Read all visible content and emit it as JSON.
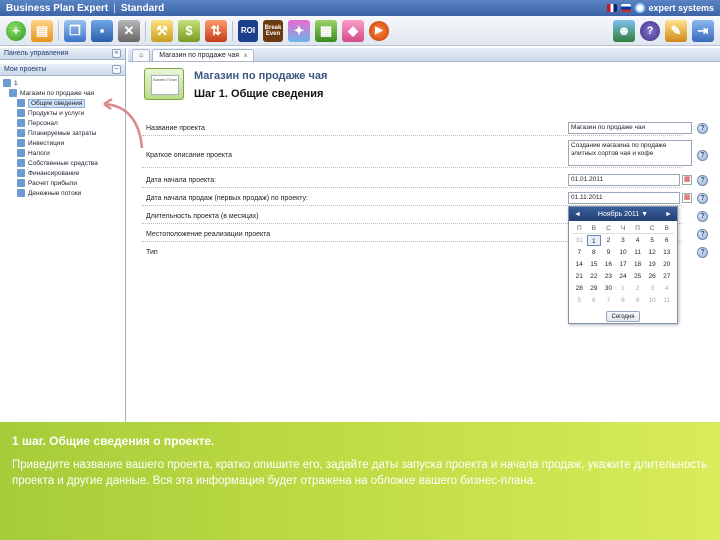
{
  "titlebar": {
    "brand": "Business Plan Expert",
    "separator": "|",
    "edition": "Standard",
    "company": "expert systems"
  },
  "toolbar": {
    "icons": [
      "add-icon",
      "open-icon",
      "copy-icon",
      "save-icon",
      "delete-icon",
      "tools-icon",
      "bag-icon",
      "import-export-icon",
      "roi-icon",
      "break-even-icon",
      "star-icon",
      "excel-icon",
      "pink-icon",
      "play-icon",
      "user-icon",
      "help-icon",
      "edit-icon",
      "exit-icon"
    ],
    "roi_label": "ROI",
    "break_even_label": "Break Even",
    "help_label": "?"
  },
  "sidebar": {
    "panel_title": "Панель управления",
    "collapse_label": "«",
    "projects_label": "Мои проекты",
    "projects_btn": "–",
    "items": [
      {
        "label": "1"
      },
      {
        "label": "Магазин по продаже чая"
      },
      {
        "label": "Общие сведения"
      },
      {
        "label": "Продукты и услуги"
      },
      {
        "label": "Персонал"
      },
      {
        "label": "Планируемые затраты"
      },
      {
        "label": "Инвестиции"
      },
      {
        "label": "Налоги"
      },
      {
        "label": "Собственные средства"
      },
      {
        "label": "Финансирование"
      },
      {
        "label": "Расчет прибыли"
      },
      {
        "label": "Денежные потоки"
      }
    ]
  },
  "tabs": {
    "home_icon": "home-icon",
    "active": "Магазин по продаже чая",
    "close": "x"
  },
  "wizard": {
    "title": "Магазин по продаже чая",
    "step": "Шаг 1. Общие сведения",
    "icon_label": "Бизнес План"
  },
  "form": {
    "rows": [
      {
        "label": "Название проекта",
        "value": "Магазин по продаже чая"
      },
      {
        "label": "Краткое описание проекта",
        "value": "Создание магазина по продаже элитных сортов чая и кофе"
      },
      {
        "label": "Дата начала проекта:",
        "value": "01.01.2011"
      },
      {
        "label": "Дата начала продаж (первых продаж) по проекту:",
        "value": "01.11.2011"
      },
      {
        "label": "Длительность проекта (в месяцах)",
        "value": ""
      },
      {
        "label": "Местоположение реализации проекта",
        "value": ""
      },
      {
        "label": "Тип",
        "value": ""
      }
    ],
    "help": "?",
    "cal_icon": "calendar-icon",
    "cal_glyph": "▦"
  },
  "datepicker": {
    "prev": "◄",
    "next": "►",
    "month_label": "Ноябрь 2011 ▼",
    "weekdays": [
      "П",
      "В",
      "С",
      "Ч",
      "П",
      "С",
      "В"
    ],
    "days": [
      [
        "31",
        "1",
        "2",
        "3",
        "4",
        "5",
        "6"
      ],
      [
        "7",
        "8",
        "9",
        "10",
        "11",
        "12",
        "13"
      ],
      [
        "14",
        "15",
        "16",
        "17",
        "18",
        "19",
        "20"
      ],
      [
        "21",
        "22",
        "23",
        "24",
        "25",
        "26",
        "27"
      ],
      [
        "28",
        "29",
        "30",
        "1",
        "2",
        "3",
        "4"
      ],
      [
        "5",
        "6",
        "7",
        "8",
        "9",
        "10",
        "11"
      ]
    ],
    "selected": "1",
    "today_label": "Сегодня"
  },
  "banner": {
    "title": "1 шаг. Общие сведения о проекте.",
    "text": "Приведите название вашего проекта, кратко опишите его, задайте даты запуска проекта и начала продаж, укажите длительность проекта и другие данные. Вся эта информация будет отражена на обложке вашего бизнес-плана."
  }
}
